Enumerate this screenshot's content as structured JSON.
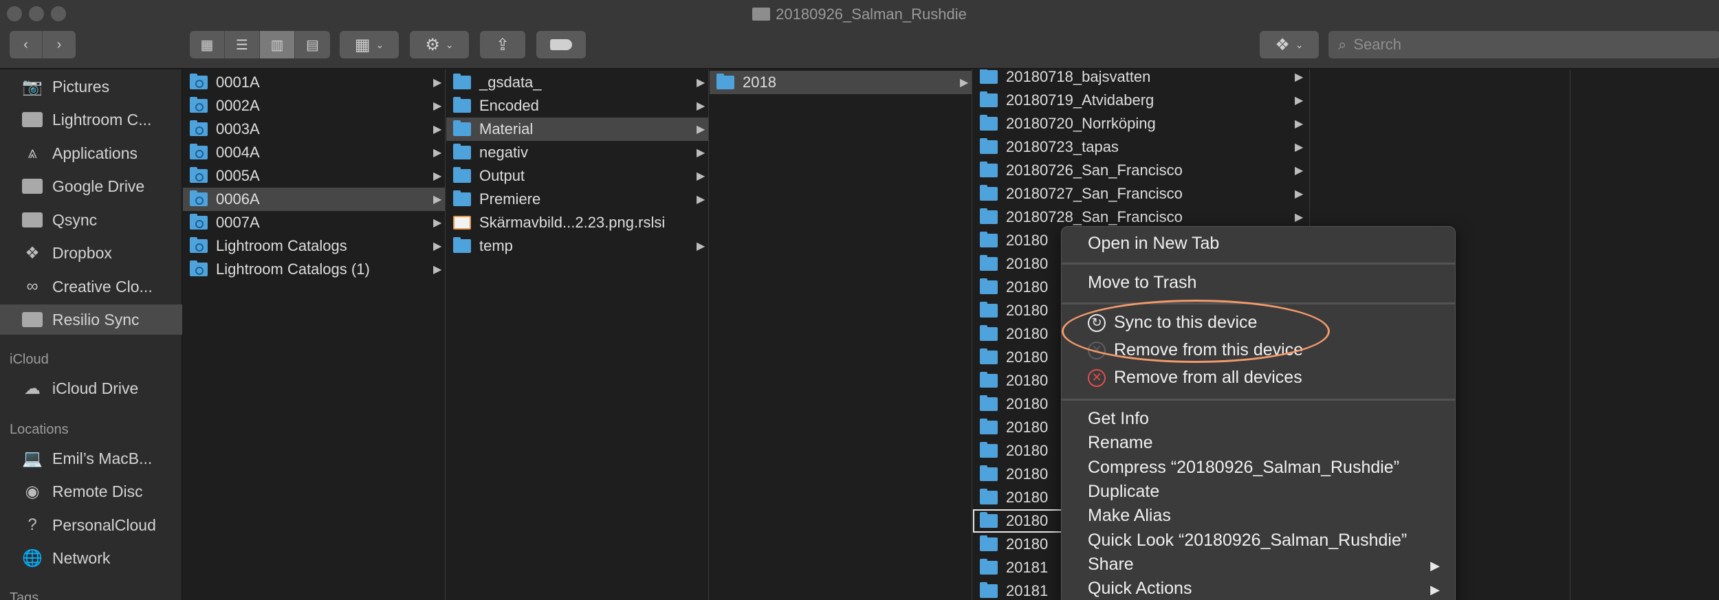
{
  "window": {
    "title": "20180926_Salman_Rushdie"
  },
  "toolbar": {
    "nav_back": "‹",
    "nav_forward": "›",
    "search_placeholder": "Search"
  },
  "sidebar": {
    "items": [
      {
        "label": "Pictures",
        "icon": "camera-icon"
      },
      {
        "label": "Lightroom C...",
        "icon": "folder-icon"
      },
      {
        "label": "Applications",
        "icon": "applications-icon"
      },
      {
        "label": "Google Drive",
        "icon": "folder-icon"
      },
      {
        "label": "Qsync",
        "icon": "folder-icon"
      },
      {
        "label": "Dropbox",
        "icon": "dropbox-icon"
      },
      {
        "label": "Creative Clo...",
        "icon": "creative-cloud-icon"
      },
      {
        "label": "Resilio Sync",
        "icon": "folder-icon"
      }
    ],
    "icloud_header": "iCloud",
    "icloud_items": [
      {
        "label": "iCloud Drive",
        "icon": "cloud-icon"
      }
    ],
    "locations_header": "Locations",
    "location_items": [
      {
        "label": "Emil’s MacB...",
        "icon": "laptop-icon"
      },
      {
        "label": "Remote Disc",
        "icon": "disc-icon"
      },
      {
        "label": "PersonalCloud",
        "icon": "question-icon"
      },
      {
        "label": "Network",
        "icon": "globe-icon"
      }
    ],
    "tags_header": "Tags"
  },
  "columns": {
    "col1": [
      "0001A",
      "0002A",
      "0003A",
      "0004A",
      "0005A",
      "0006A",
      "0007A",
      "Lightroom Catalogs",
      "Lightroom Catalogs (1)"
    ],
    "col2": [
      "_gsdata_",
      "Encoded",
      "Material",
      "negativ",
      "Output",
      "Premiere",
      "Skärmavbild...2.23.png.rslsi",
      "temp"
    ],
    "col3": [
      "2018"
    ],
    "col4": [
      "20180718_bajsvatten",
      "20180719_Atvidaberg",
      "20180720_Norrköping",
      "20180723_tapas",
      "20180726_San_Francisco",
      "20180727_San_Francisco",
      "20180728_San_Francisco",
      "20180",
      "20180",
      "20180",
      "20180",
      "20180",
      "20180",
      "20180",
      "20180",
      "20180",
      "20180",
      "20180",
      "20180",
      "20180",
      "20180",
      "20181",
      "20181"
    ]
  },
  "context_menu": {
    "open_new_tab": "Open in New Tab",
    "move_to_trash": "Move to Trash",
    "sync_to_device": "Sync to this device",
    "remove_from_device": "Remove from this device",
    "remove_from_all": "Remove from all devices",
    "get_info": "Get Info",
    "rename": "Rename",
    "compress": "Compress “20180926_Salman_Rushdie”",
    "duplicate": "Duplicate",
    "make_alias": "Make Alias",
    "quick_look": "Quick Look “20180926_Salman_Rushdie”",
    "share": "Share",
    "quick_actions": "Quick Actions"
  },
  "colors": {
    "folder": "#4fa3dd",
    "highlight_ring": "#f29a6b",
    "remove_all_red": "#e14d4d"
  }
}
